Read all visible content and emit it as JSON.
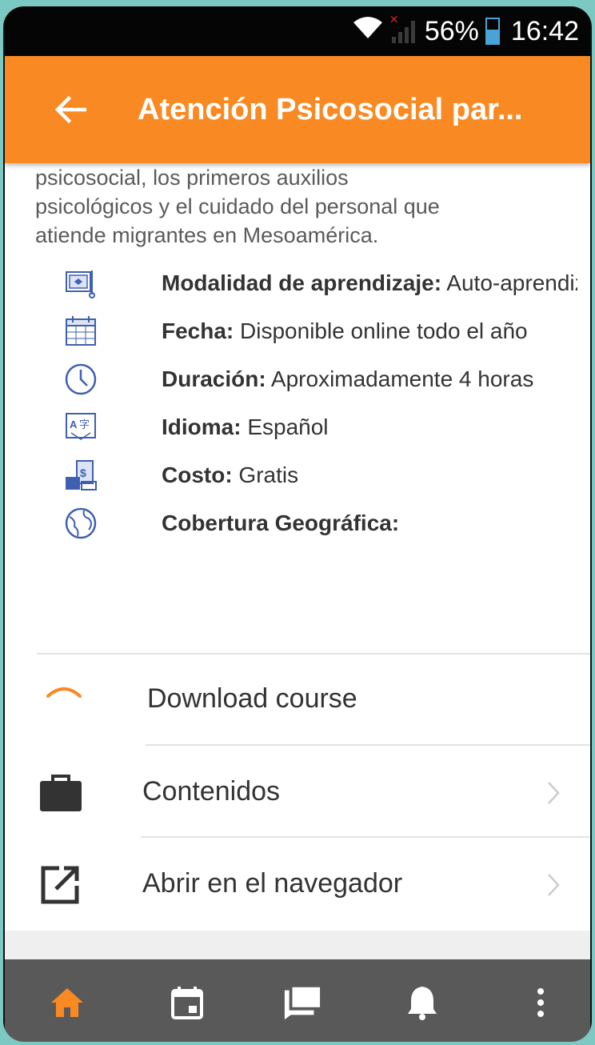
{
  "status_bar": {
    "battery_pct": "56%",
    "time": "16:42"
  },
  "header": {
    "title": "Atención Psicosocial par..."
  },
  "description": {
    "lines": [
      "psicosocial, los primeros auxilios",
      "psicológicos y el cuidado del personal que",
      "atiende migrantes en Mesoamérica."
    ]
  },
  "info": {
    "modalidad": {
      "label": "Modalidad de aprendizaje:",
      "value": " Auto-aprendizaje"
    },
    "fecha": {
      "label": "Fecha:",
      "value": " Disponible online todo el año"
    },
    "duracion": {
      "label": "Duración:",
      "value": " Aproximadamente 4 horas"
    },
    "idioma": {
      "label": "Idioma:",
      "value": " Español"
    },
    "costo": {
      "label": "Costo:",
      "value": " Gratis"
    },
    "cobertura": {
      "label": "Cobertura Geográfica:",
      "value": ""
    }
  },
  "menu": {
    "download": "Download course",
    "contenidos": "Contenidos",
    "navegador": "Abrir en el navegador"
  },
  "colors": {
    "accent": "#f98a23",
    "icon_blue": "#3f5fb0",
    "nav_bg": "#595959"
  },
  "icons": {
    "modalidad": "certificate-icon",
    "fecha": "calendar-icon",
    "duracion": "clock-icon",
    "idioma": "translate-icon",
    "costo": "money-icon",
    "cobertura": "globe-icon"
  }
}
